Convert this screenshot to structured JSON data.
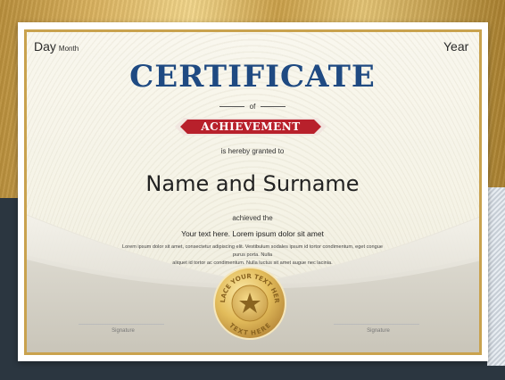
{
  "header": {
    "day": "Day",
    "month": "Month",
    "year": "Year"
  },
  "title": "CERTIFICATE",
  "of": "of",
  "ribbon": "ACHIEVEMENT",
  "granted": "is hereby granted to",
  "name": "Name and Surname",
  "achieved": "achieved the",
  "your_text": "Your text here. Lorem ipsum dolor sit amet",
  "lorem_line1": "Lorem ipsum dolor sit amet, consectetur adipiscing elit. Vestibulum sodales ipsum id tortor condimentum, eget congue purus porta. Nulla",
  "lorem_line2": "aliquet id tortor ac condimentum. Nulla luctus sit amet augue nec lacinia.",
  "seal": {
    "top_text": "PLACE YOUR TEXT HERE",
    "bottom_text": "TEXT HERE"
  },
  "signature_left": "Signature",
  "signature_right": "Signature",
  "colors": {
    "title": "#1f4a82",
    "ribbon": "#b8202b",
    "gold": "#c9a24e",
    "background": "#2b3640"
  }
}
